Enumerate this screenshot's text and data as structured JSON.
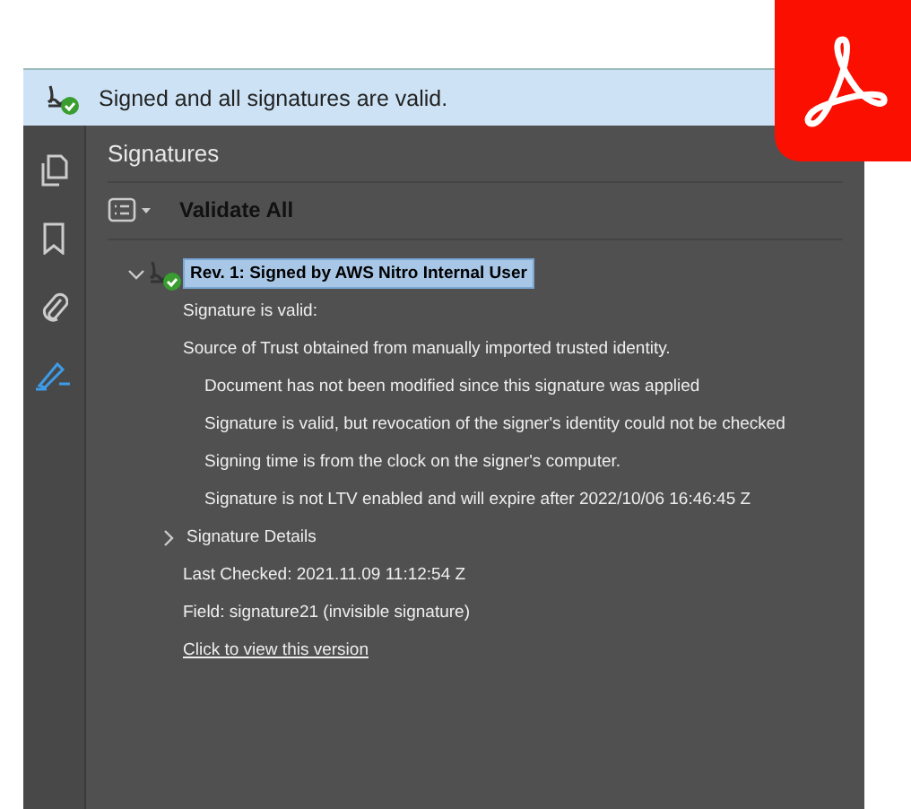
{
  "banner": {
    "text": "Signed and all signatures are valid."
  },
  "rail": [
    {
      "kind": "pages",
      "selected": false
    },
    {
      "kind": "bookmark",
      "selected": false
    },
    {
      "kind": "attachment",
      "selected": false
    },
    {
      "kind": "signature",
      "selected": true
    }
  ],
  "panel": {
    "title": "Signatures",
    "toolbar_label": "Validate All"
  },
  "tree": [
    {
      "label": "Rev. 1: Signed by AWS Nitro Internal User",
      "expanded": true,
      "selected": true,
      "children": [
        {
          "label": "Signature is valid:"
        },
        {
          "label": "Source of Trust obtained from manually imported trusted identity.",
          "children": [
            {
              "label": "Document has not been modified since this signature was applied"
            },
            {
              "label": "Signature is valid, but revocation of the signer's identity could not be checked"
            },
            {
              "label": "Signing time is from the clock on the signer's computer."
            },
            {
              "label": "Signature is not LTV enabled and will expire after 2022/10/06 16:46:45 Z"
            }
          ]
        },
        {
          "label": "Signature Details",
          "expanded": false
        },
        {
          "label": "Last Checked: 2021.11.09 11:12:54 Z"
        },
        {
          "label": "Field: signature21 (invisible signature)"
        },
        {
          "label": "Click to view this version",
          "kind": "link"
        }
      ]
    }
  ]
}
